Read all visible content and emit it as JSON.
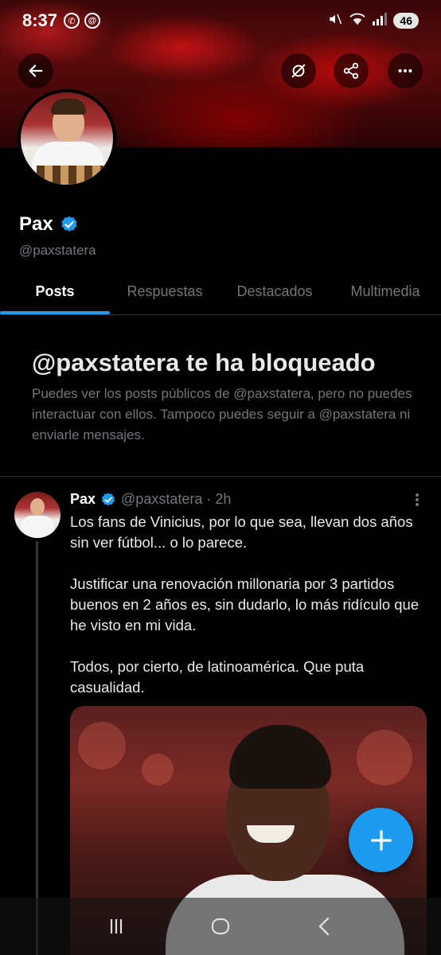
{
  "status_bar": {
    "time": "8:37",
    "battery": "46",
    "left_icons": [
      "whatsapp-icon",
      "at-icon"
    ],
    "right_icons": [
      "mute-icon",
      "wifi-icon",
      "signal-icon"
    ]
  },
  "header": {
    "buttons": [
      "back-icon",
      "grok-icon",
      "share-icon",
      "more-icon"
    ]
  },
  "profile": {
    "name": "Pax",
    "handle": "@paxstatera",
    "verified_color": "#1d9bf0"
  },
  "tabs": [
    {
      "label": "Posts",
      "active": true
    },
    {
      "label": "Respuestas",
      "active": false
    },
    {
      "label": "Destacados",
      "active": false
    },
    {
      "label": "Multimedia",
      "active": false
    }
  ],
  "blocked": {
    "title": "@paxstatera te ha bloqueado",
    "description": "Puedes ver los posts públicos de @paxstatera, pero no puedes interactuar con ellos. Tampoco puedes seguir a @paxstatera ni enviarle mensajes."
  },
  "post": {
    "name": "Pax",
    "meta": "@paxstatera · 2h",
    "paragraphs": [
      "Los fans de Vinicius, por lo que sea, llevan dos años sin ver fútbol... o lo parece.",
      "Justificar una renovación millonaria por 3 partidos buenos en 2 años es, sin dudarlo, lo más ridículo que he visto en mi vida.",
      "Todos, por cierto, de latinoamérica. Que puta casualidad."
    ]
  },
  "colors": {
    "accent": "#1d9bf0",
    "background": "#000000",
    "secondary_text": "#71767b"
  }
}
